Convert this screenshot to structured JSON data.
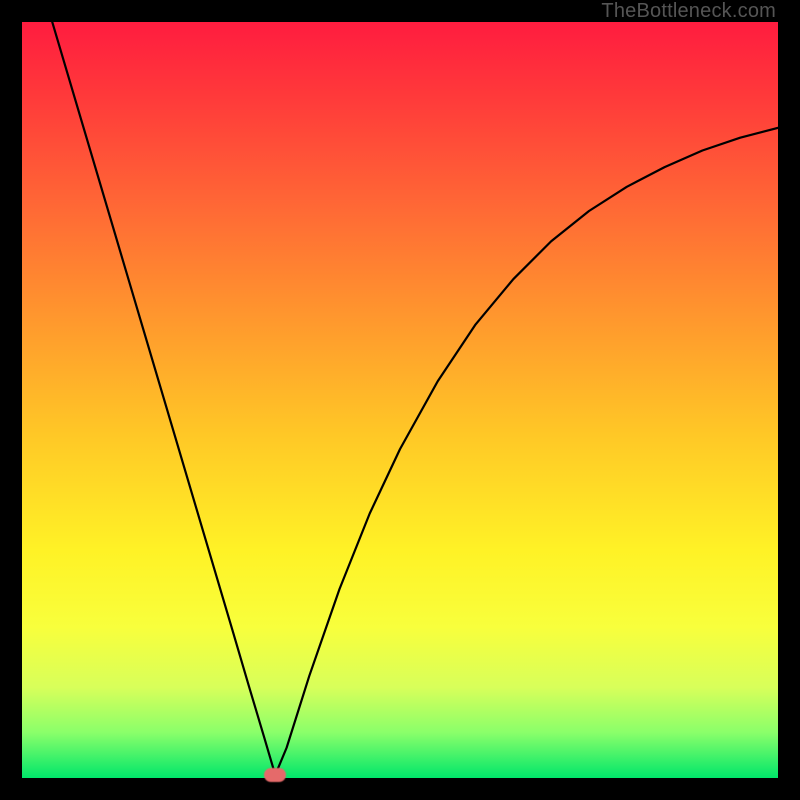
{
  "watermark": "TheBottleneck.com",
  "colors": {
    "frame": "#000000",
    "curve": "#000000",
    "marker": "#e56a6a"
  },
  "chart_data": {
    "type": "line",
    "title": "",
    "xlabel": "",
    "ylabel": "",
    "xlim": [
      0,
      100
    ],
    "ylim": [
      0,
      100
    ],
    "grid": false,
    "legend": false,
    "series": [
      {
        "name": "bottleneck-curve",
        "x": [
          4,
          8,
          12,
          16,
          20,
          24,
          28,
          30,
          32,
          33.5,
          35,
          38,
          42,
          46,
          50,
          55,
          60,
          65,
          70,
          75,
          80,
          85,
          90,
          95,
          100
        ],
        "y": [
          100,
          86.5,
          73,
          59.5,
          46,
          32.5,
          19,
          12.2,
          5.5,
          0.4,
          4,
          13.5,
          25,
          35,
          43.5,
          52.5,
          60,
          66,
          71,
          75,
          78.2,
          80.8,
          83,
          84.7,
          86
        ]
      }
    ],
    "marker": {
      "x": 33.5,
      "y": 0.4
    },
    "gradient_stops": [
      {
        "pos": 0,
        "color": "#ff1c3f"
      },
      {
        "pos": 10,
        "color": "#ff3a3a"
      },
      {
        "pos": 25,
        "color": "#ff6a35"
      },
      {
        "pos": 40,
        "color": "#ff9a2d"
      },
      {
        "pos": 55,
        "color": "#ffc926"
      },
      {
        "pos": 70,
        "color": "#fff226"
      },
      {
        "pos": 80,
        "color": "#f8ff3c"
      },
      {
        "pos": 88,
        "color": "#d8ff5a"
      },
      {
        "pos": 94,
        "color": "#8aff6a"
      },
      {
        "pos": 100,
        "color": "#00e66a"
      }
    ]
  }
}
